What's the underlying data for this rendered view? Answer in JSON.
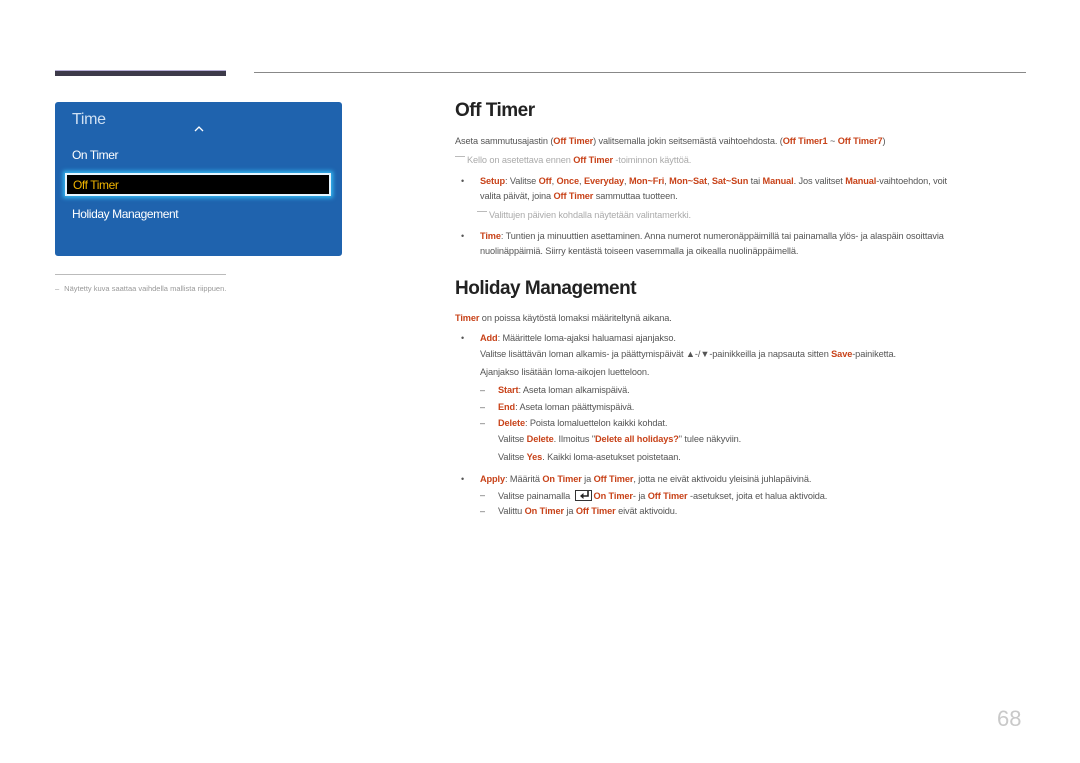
{
  "menu": {
    "title": "Time",
    "items": [
      {
        "label": "On Timer",
        "selected": false
      },
      {
        "label": "Off Timer",
        "selected": true
      },
      {
        "label": "Holiday Management",
        "selected": false
      }
    ],
    "chevron_icon": "chevron-up-icon"
  },
  "footnote": {
    "dash": "–",
    "text": "Näytetty kuva saattaa vaihdella mallista riippuen."
  },
  "off_timer": {
    "heading": "Off Timer",
    "intro": {
      "p1": "Aseta sammutusajastin (",
      "k1": "Off Timer",
      "p2": ") valitsemalla jokin seitsemästä vaihtoehdosta. (",
      "k2": "Off Timer1",
      "p3": " ~ ",
      "k3": "Off Timer7",
      "p4": ")"
    },
    "note1": {
      "p1": "Kello on asetettava ennen ",
      "k1": "Off Timer",
      "p2": " -toiminnon käyttöä."
    },
    "setup": {
      "bullet": "•",
      "k_setup": "Setup",
      "p1": ": Valitse ",
      "k_off": "Off",
      "k_once": "Once",
      "k_everyday": "Everyday",
      "k_monfri": "Mon~Fri",
      "k_monsat": "Mon~Sat",
      "k_satsun": "Sat~Sun",
      "p_tai": " tai ",
      "k_manual": "Manual",
      "p2": ". Jos valitset ",
      "k_manual2": "Manual",
      "p3": "-vaihtoehdon, voit",
      "line2_p1": "valita päivät, joina ",
      "line2_k": "Off Timer",
      "line2_p2": " sammuttaa tuotteen.",
      "note": "Valittujen päivien kohdalla näytetään valintamerkki."
    },
    "time": {
      "bullet": "•",
      "k": "Time",
      "line1": ": Tuntien ja minuuttien asettaminen. Anna numerot numeronäppäimillä tai painamalla ylös- ja alaspäin osoittavia",
      "line2": "nuolinäppäimiä. Siirry kentästä toiseen vasemmalla ja oikealla nuolinäppäimellä."
    }
  },
  "holiday": {
    "heading": "Holiday Management",
    "intro_k": "Timer",
    "intro_p": " on poissa käytöstä lomaksi määriteltynä aikana.",
    "add": {
      "bullet": "•",
      "k": "Add",
      "p": ": Määrittele loma-ajaksi haluamasi ajanjakso.",
      "line2_p1": "Valitse lisättävän loman alkamis- ja päättymispäivät ▲-/▼-painikkeilla ja napsauta sitten ",
      "line2_k": "Save",
      "line2_p2": "-painiketta.",
      "line3": "Ajanjakso lisätään loma-aikojen luetteloon."
    },
    "sub": [
      {
        "dash": "–",
        "k": "Start",
        "p": ": Aseta loman alkamispäivä."
      },
      {
        "dash": "–",
        "k": "End",
        "p": ": Aseta loman päättymispäivä."
      },
      {
        "dash": "–",
        "k": "Delete",
        "p": ": Poista lomaluettelon kaikki kohdat."
      }
    ],
    "delete_line2": {
      "p1": "Valitse ",
      "k1": "Delete",
      "p2": ". Ilmoitus \"",
      "k2": "Delete all holidays?",
      "p3": "\" tulee näkyviin."
    },
    "delete_line3": {
      "p1": "Valitse ",
      "k1": "Yes",
      "p2": ". Kaikki loma-asetukset poistetaan."
    },
    "apply": {
      "bullet": "•",
      "k": "Apply",
      "p1": ": Määritä ",
      "k_on": "On Timer",
      "p_ja": " ja ",
      "k_off": "Off Timer",
      "p2": ", jotta ne eivät aktivoidu yleisinä juhlapäivinä.",
      "sub1": {
        "dash": "–",
        "p1": "Valitse painamalla ",
        "icon": "enter-key-icon",
        "k_on": "On Timer",
        "p2": "- ja ",
        "k_off": "Off Timer",
        "p3": " -asetukset, joita et halua aktivoida."
      },
      "sub2": {
        "dash": "–",
        "p1": "Valittu ",
        "k_on": "On Timer",
        "p2": " ja ",
        "k_off": "Off Timer",
        "p3": " eivät aktivoidu."
      }
    }
  },
  "page_number": "68",
  "colors": {
    "panel_blue": "#1f63ae",
    "highlight_text": "#f0b400",
    "keyword_red": "#c8431a",
    "glow": "#33b6f0"
  }
}
